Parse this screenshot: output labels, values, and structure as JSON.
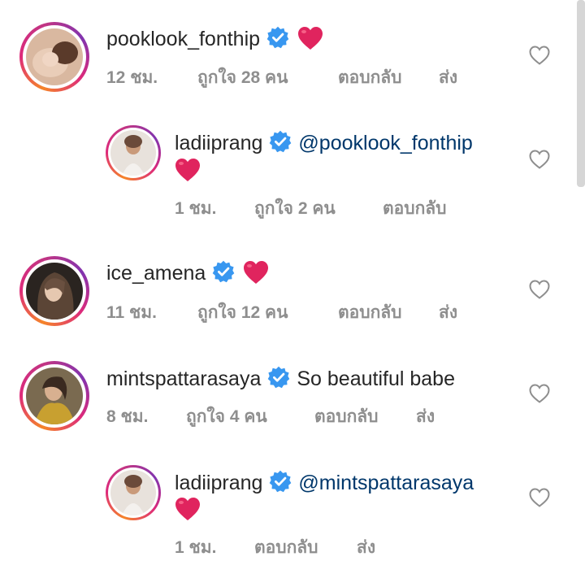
{
  "comments": [
    {
      "username": "pooklook_fonthip",
      "verified": true,
      "text": "",
      "emoji": "heart",
      "time": "12 ชม.",
      "likes": "ถูกใจ 28 คน",
      "reply": "ตอบกลับ",
      "send": "ส่ง"
    },
    {
      "username": "ladiiprang",
      "verified": true,
      "mention": "@pooklook_fonthip",
      "emoji": "heart",
      "time": "1 ชม.",
      "likes": "ถูกใจ 2 คน",
      "reply": "ตอบกลับ"
    },
    {
      "username": "ice_amena",
      "verified": true,
      "emoji": "heart",
      "time": "11 ชม.",
      "likes": "ถูกใจ 12 คน",
      "reply": "ตอบกลับ",
      "send": "ส่ง"
    },
    {
      "username": "mintspattarasaya",
      "verified": true,
      "text": "So beautiful babe",
      "time": "8 ชม.",
      "likes": "ถูกใจ 4 คน",
      "reply": "ตอบกลับ",
      "send": "ส่ง"
    },
    {
      "username": "ladiiprang",
      "verified": true,
      "mention": "@mintspattarasaya",
      "emoji": "heart",
      "time": "1 ชม.",
      "reply": "ตอบกลับ",
      "send": "ส่ง"
    }
  ],
  "colors": {
    "username": "#262626",
    "meta": "#8e8e8e",
    "mention": "#00376b",
    "verified": "#3897f0",
    "heart": "#e0245e"
  },
  "icons": [
    "verified-badge-icon",
    "red-heart-emoji",
    "like-heart-outline-icon"
  ]
}
